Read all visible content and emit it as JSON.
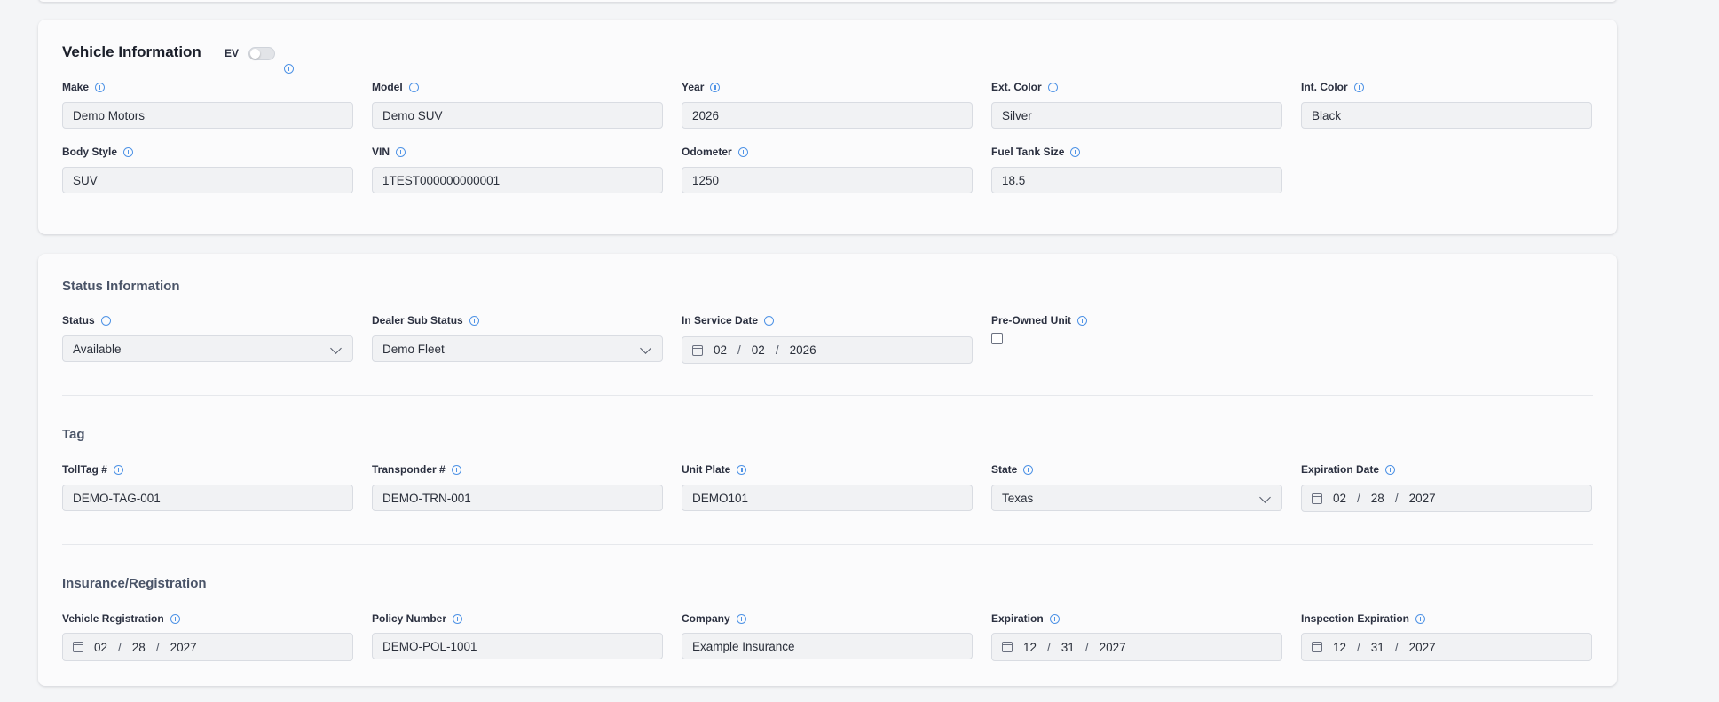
{
  "vehicle": {
    "title": "Vehicle Information",
    "ev_label": "EV",
    "ev_on": false,
    "fields": [
      {
        "label": "Make",
        "value": "Demo Motors"
      },
      {
        "label": "Model",
        "value": "Demo SUV"
      },
      {
        "label": "Year",
        "value": "2026"
      },
      {
        "label": "Ext. Color",
        "value": "Silver"
      },
      {
        "label": "Int. Color",
        "value": "Black"
      },
      {
        "label": "Body Style",
        "value": "SUV"
      },
      {
        "label": "VIN",
        "value": "1TEST000000000001"
      },
      {
        "label": "Odometer",
        "value": "1250"
      },
      {
        "label": "Fuel Tank Size",
        "value": "18.5"
      }
    ]
  },
  "status": {
    "title": "Status Information",
    "status_label": "Status",
    "status_value": "Available",
    "dealer_sub_status_label": "Dealer Sub Status",
    "dealer_sub_status_value": "Demo Fleet",
    "in_service_label": "In Service Date",
    "in_service_date": {
      "mm": "02",
      "dd": "02",
      "yyyy": "2026"
    },
    "pre_owned_label": "Pre-Owned Unit",
    "pre_owned_checked": false
  },
  "tag": {
    "title": "Tag",
    "tolltag_label": "TollTag #",
    "tolltag_value": "DEMO-TAG-001",
    "transponder_label": "Transponder #",
    "transponder_value": "DEMO-TRN-001",
    "unit_plate_label": "Unit Plate",
    "unit_plate_value": "DEMO101",
    "state_label": "State",
    "state_value": "Texas",
    "expiration_label": "Expiration Date",
    "expiration_date": {
      "mm": "02",
      "dd": "28",
      "yyyy": "2027"
    }
  },
  "insurance": {
    "title": "Insurance/Registration",
    "registration_label": "Vehicle Registration",
    "registration_date": {
      "mm": "02",
      "dd": "28",
      "yyyy": "2027"
    },
    "policy_label": "Policy Number",
    "policy_value": "DEMO-POL-1001",
    "company_label": "Company",
    "company_value": "Example Insurance",
    "expiration_label": "Expiration",
    "expiration_date": {
      "mm": "12",
      "dd": "31",
      "yyyy": "2027"
    },
    "inspection_label": "Inspection Expiration",
    "inspection_date": {
      "mm": "12",
      "dd": "31",
      "yyyy": "2027"
    }
  },
  "date_separator": "/",
  "icons": {
    "info": "info-circle-icon",
    "calendar": "calendar-icon",
    "chevron": "chevron-down-icon"
  },
  "colors": {
    "info_icon": "#4f93e6",
    "section_title": "#4a5468",
    "field_bg": "#f1f2f4"
  }
}
